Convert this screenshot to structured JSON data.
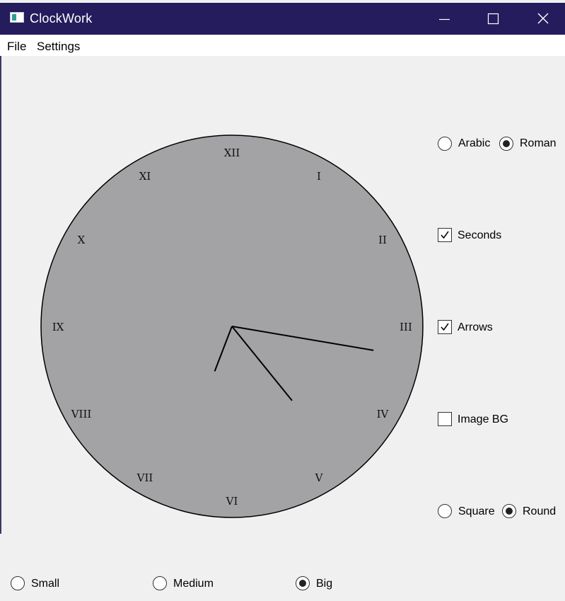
{
  "window": {
    "title": "ClockWork",
    "icon": "app-window-icon",
    "controls": [
      "minimize-icon",
      "maximize-icon",
      "close-icon"
    ],
    "titlebar_color": "#241c5c"
  },
  "menu": {
    "items": [
      {
        "label": "File"
      },
      {
        "label": "Settings"
      }
    ]
  },
  "clock": {
    "face_color": "#a3a2a5",
    "numerals": [
      "XII",
      "I",
      "II",
      "III",
      "IV",
      "V",
      "VI",
      "VII",
      "VIII",
      "IX",
      "X",
      "XI"
    ],
    "hands": {
      "hour": {
        "time_value": 6.7,
        "unit": "hours"
      },
      "minute": {
        "time_value": 23.5,
        "unit": "minutes"
      },
      "second": {
        "time_value": 16.6,
        "unit": "seconds"
      }
    }
  },
  "options": {
    "numeral_style": {
      "options": [
        "Arabic",
        "Roman"
      ],
      "selected": "Roman"
    },
    "seconds": {
      "label": "Seconds",
      "checked": true
    },
    "arrows": {
      "label": "Arrows",
      "checked": true
    },
    "image_bg": {
      "label": "Image BG",
      "checked": false
    },
    "shape": {
      "options": [
        "Square",
        "Round"
      ],
      "selected": "Round"
    },
    "size": {
      "options": [
        "Small",
        "Medium",
        "Big"
      ],
      "selected": "Big"
    }
  }
}
